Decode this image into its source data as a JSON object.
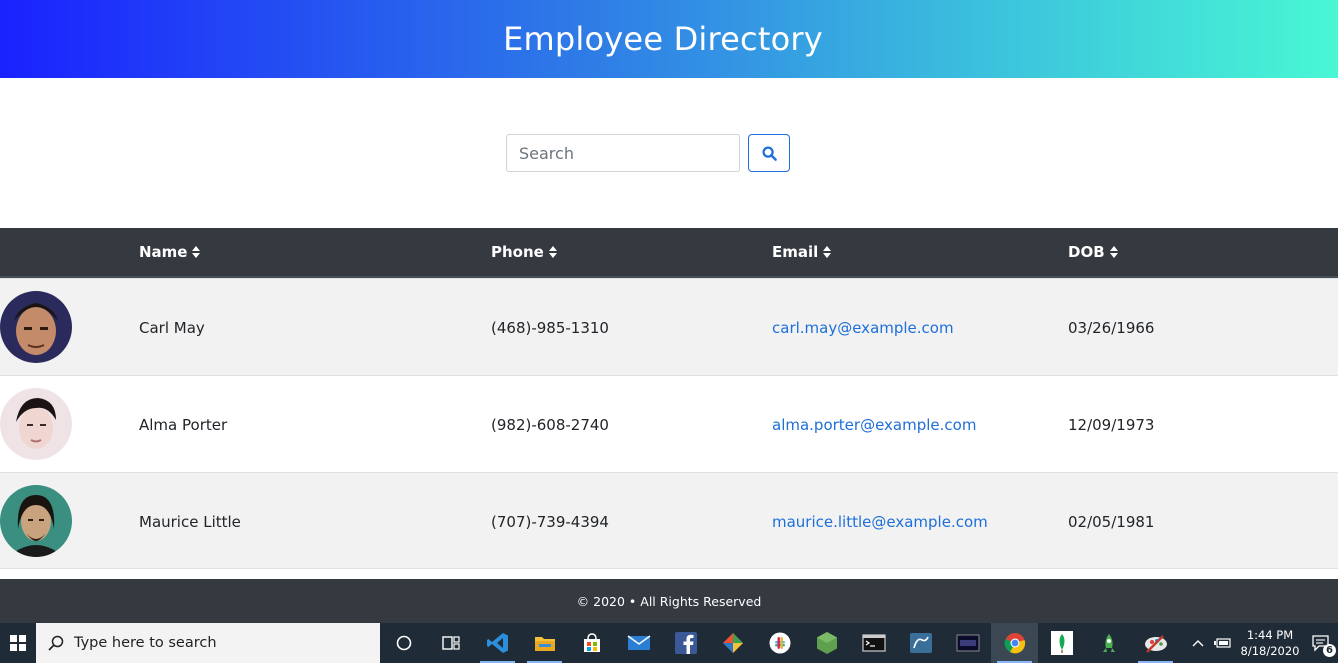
{
  "header": {
    "title": "Employee Directory"
  },
  "search": {
    "placeholder": "Search",
    "value": ""
  },
  "table": {
    "columns": [
      {
        "label": "Name"
      },
      {
        "label": "Phone"
      },
      {
        "label": "Email"
      },
      {
        "label": "DOB"
      }
    ],
    "rows": [
      {
        "name": "Carl May",
        "phone": "(468)-985-1310",
        "email": "carl.may@example.com",
        "dob": "03/26/1966"
      },
      {
        "name": "Alma Porter",
        "phone": "(982)-608-2740",
        "email": "alma.porter@example.com",
        "dob": "12/09/1973"
      },
      {
        "name": "Maurice Little",
        "phone": "(707)-739-4394",
        "email": "maurice.little@example.com",
        "dob": "02/05/1981"
      }
    ]
  },
  "footer": {
    "text": "© 2020 • All Rights Reserved"
  },
  "taskbar": {
    "search_placeholder": "Type here to search",
    "time": "1:44 PM",
    "date": "8/18/2020",
    "notification_count": "6",
    "apps": [
      "cortana-icon",
      "task-view-icon",
      "vscode-icon",
      "file-explorer-icon",
      "store-icon",
      "mail-icon",
      "facebook-icon",
      "git-icon",
      "slack-icon",
      "nodejs-icon",
      "terminal-icon",
      "mysql-workbench-icon",
      "terminal-dark-icon",
      "chrome-icon",
      "mongodb-icon",
      "robo3t-icon",
      "paint-icon"
    ]
  },
  "colors": {
    "header_gradient_start": "#1a22ff",
    "header_gradient_end": "#48f7d4",
    "table_header_bg": "#343a40",
    "link": "#1e6fd9",
    "row_stripe": "#f2f2f2"
  }
}
